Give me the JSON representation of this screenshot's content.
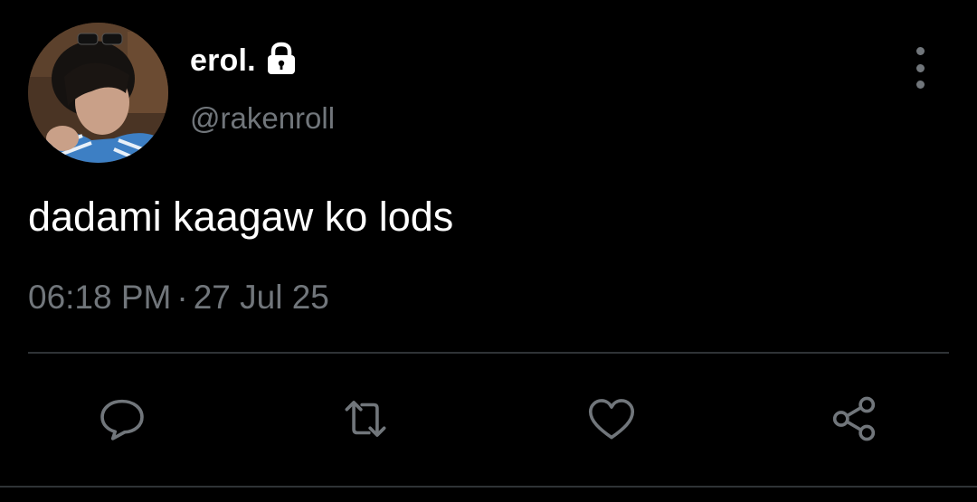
{
  "tweet": {
    "author": {
      "display_name": "erol.",
      "handle": "@rakenroll",
      "protected": true
    },
    "text": "dadami kaagaw ko lods",
    "time": "06:18 PM",
    "separator": "·",
    "date": "27 Jul 25"
  },
  "actions": [
    {
      "name": "reply",
      "icon": "reply-icon"
    },
    {
      "name": "retweet",
      "icon": "retweet-icon"
    },
    {
      "name": "like",
      "icon": "heart-icon"
    },
    {
      "name": "share",
      "icon": "share-icon"
    }
  ],
  "colors": {
    "background": "#000000",
    "primary_text": "#ffffff",
    "secondary_text": "#71767b",
    "divider": "#2f3336"
  }
}
